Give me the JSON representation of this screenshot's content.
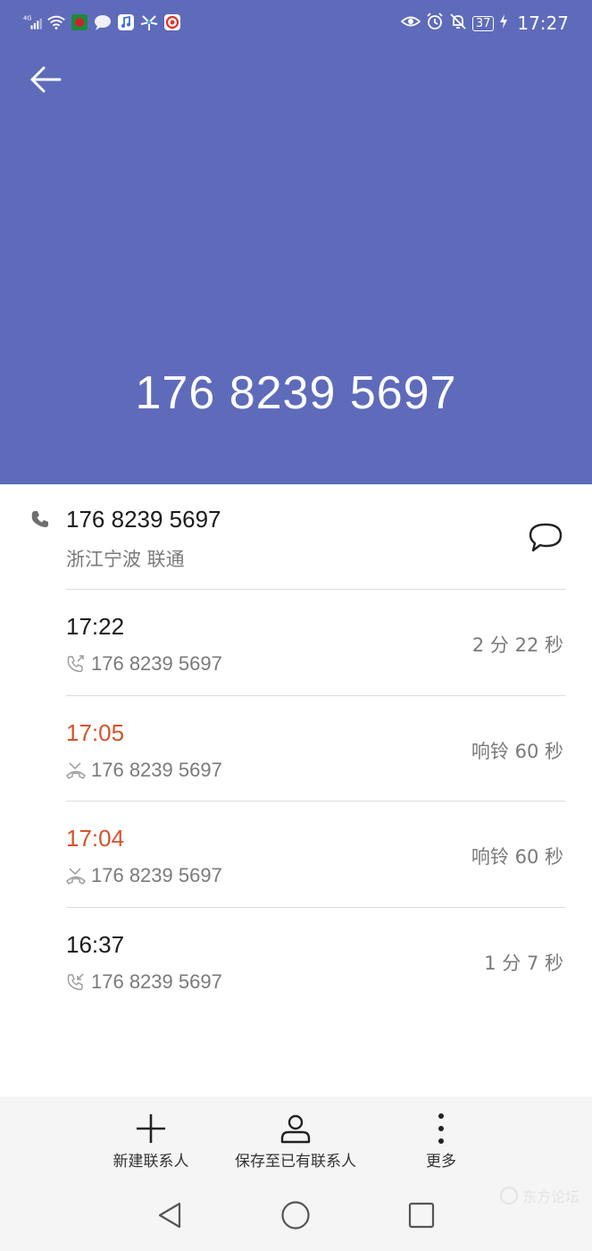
{
  "status_bar": {
    "network": "4G",
    "battery": "37",
    "time": "17:27"
  },
  "header": {
    "number": "176 8239 5697",
    "bg_color": "#5e6bba"
  },
  "contact": {
    "number": "176 8239 5697",
    "location": "浙江宁波 联通"
  },
  "calls": [
    {
      "time": "17:22",
      "type": "outgoing",
      "number": "176 8239 5697",
      "duration": "2 分 22 秒",
      "missed": false
    },
    {
      "time": "17:05",
      "type": "missed",
      "number": "176 8239 5697",
      "duration": "响铃 60 秒",
      "missed": true
    },
    {
      "time": "17:04",
      "type": "missed",
      "number": "176 8239 5697",
      "duration": "响铃 60 秒",
      "missed": true
    },
    {
      "time": "16:37",
      "type": "incoming",
      "number": "176 8239 5697",
      "duration": "1 分 7 秒",
      "missed": false
    }
  ],
  "actions": {
    "new_contact": "新建联系人",
    "save_existing": "保存至已有联系人",
    "more": "更多"
  },
  "watermark": "东方论坛",
  "colors": {
    "missed": "#d4542a",
    "secondary_text": "#7a7a7a"
  }
}
